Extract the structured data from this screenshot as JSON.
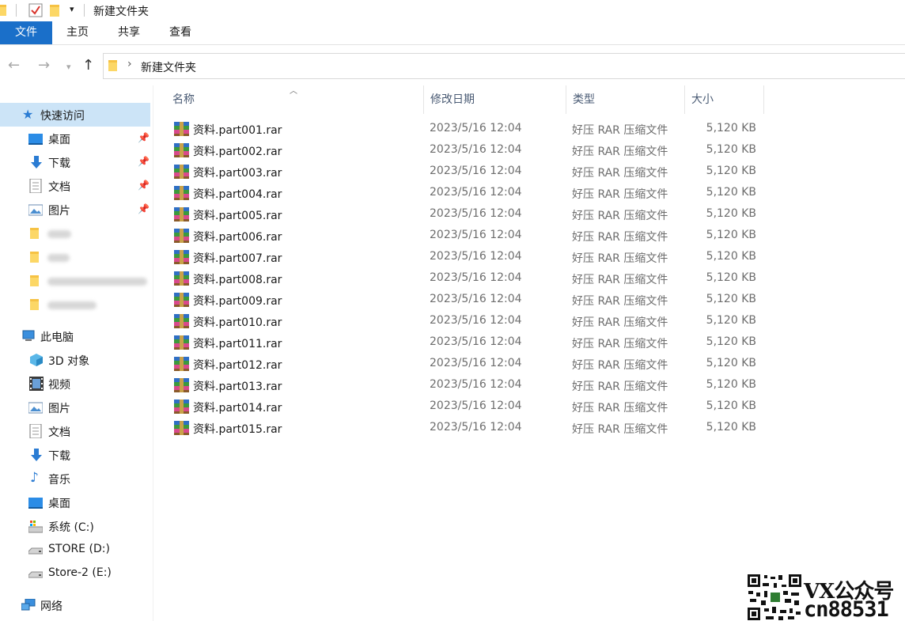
{
  "window": {
    "title": "新建文件夹"
  },
  "ribbon": {
    "tabs": [
      "文件",
      "主页",
      "共享",
      "查看"
    ],
    "active": "文件"
  },
  "address": {
    "path": [
      "新建文件夹"
    ]
  },
  "sidebar": {
    "quick_access": "快速访问",
    "quick_items": [
      {
        "label": "桌面",
        "icon": "desktop-icon",
        "pinned": true
      },
      {
        "label": "下载",
        "icon": "download-icon",
        "pinned": true
      },
      {
        "label": "文档",
        "icon": "document-icon",
        "pinned": true
      },
      {
        "label": "图片",
        "icon": "pictures-icon",
        "pinned": true
      }
    ],
    "this_pc": "此电脑",
    "pc_items": [
      {
        "label": "3D 对象",
        "icon": "3d-objects-icon"
      },
      {
        "label": "视频",
        "icon": "video-icon"
      },
      {
        "label": "图片",
        "icon": "pictures-icon"
      },
      {
        "label": "文档",
        "icon": "document-icon"
      },
      {
        "label": "下载",
        "icon": "download-icon"
      },
      {
        "label": "音乐",
        "icon": "music-icon"
      },
      {
        "label": "桌面",
        "icon": "desktop-icon"
      },
      {
        "label": "系统 (C:)",
        "icon": "system-drive-icon"
      },
      {
        "label": "STORE (D:)",
        "icon": "drive-icon"
      },
      {
        "label": "Store-2 (E:)",
        "icon": "drive-icon"
      }
    ],
    "network": "网络"
  },
  "columns": {
    "name": "名称",
    "date": "修改日期",
    "type": "类型",
    "size": "大小"
  },
  "files": [
    {
      "name": "资料.part001.rar",
      "date": "2023/5/16 12:04",
      "type": "好压 RAR 压缩文件",
      "size": "5,120 KB"
    },
    {
      "name": "资料.part002.rar",
      "date": "2023/5/16 12:04",
      "type": "好压 RAR 压缩文件",
      "size": "5,120 KB"
    },
    {
      "name": "资料.part003.rar",
      "date": "2023/5/16 12:04",
      "type": "好压 RAR 压缩文件",
      "size": "5,120 KB"
    },
    {
      "name": "资料.part004.rar",
      "date": "2023/5/16 12:04",
      "type": "好压 RAR 压缩文件",
      "size": "5,120 KB"
    },
    {
      "name": "资料.part005.rar",
      "date": "2023/5/16 12:04",
      "type": "好压 RAR 压缩文件",
      "size": "5,120 KB"
    },
    {
      "name": "资料.part006.rar",
      "date": "2023/5/16 12:04",
      "type": "好压 RAR 压缩文件",
      "size": "5,120 KB"
    },
    {
      "name": "资料.part007.rar",
      "date": "2023/5/16 12:04",
      "type": "好压 RAR 压缩文件",
      "size": "5,120 KB"
    },
    {
      "name": "资料.part008.rar",
      "date": "2023/5/16 12:04",
      "type": "好压 RAR 压缩文件",
      "size": "5,120 KB"
    },
    {
      "name": "资料.part009.rar",
      "date": "2023/5/16 12:04",
      "type": "好压 RAR 压缩文件",
      "size": "5,120 KB"
    },
    {
      "name": "资料.part010.rar",
      "date": "2023/5/16 12:04",
      "type": "好压 RAR 压缩文件",
      "size": "5,120 KB"
    },
    {
      "name": "资料.part011.rar",
      "date": "2023/5/16 12:04",
      "type": "好压 RAR 压缩文件",
      "size": "5,120 KB"
    },
    {
      "name": "资料.part012.rar",
      "date": "2023/5/16 12:04",
      "type": "好压 RAR 压缩文件",
      "size": "5,120 KB"
    },
    {
      "name": "资料.part013.rar",
      "date": "2023/5/16 12:04",
      "type": "好压 RAR 压缩文件",
      "size": "5,120 KB"
    },
    {
      "name": "资料.part014.rar",
      "date": "2023/5/16 12:04",
      "type": "好压 RAR 压缩文件",
      "size": "5,120 KB"
    },
    {
      "name": "资料.part015.rar",
      "date": "2023/5/16 12:04",
      "type": "好压 RAR 压缩文件",
      "size": "5,120 KB"
    }
  ],
  "watermark": {
    "line1": "VX公众号",
    "line2": "cn88531"
  },
  "colors": {
    "accent": "#1a6fc9",
    "selection": "#cce4f7",
    "folder": "#f6c244"
  }
}
